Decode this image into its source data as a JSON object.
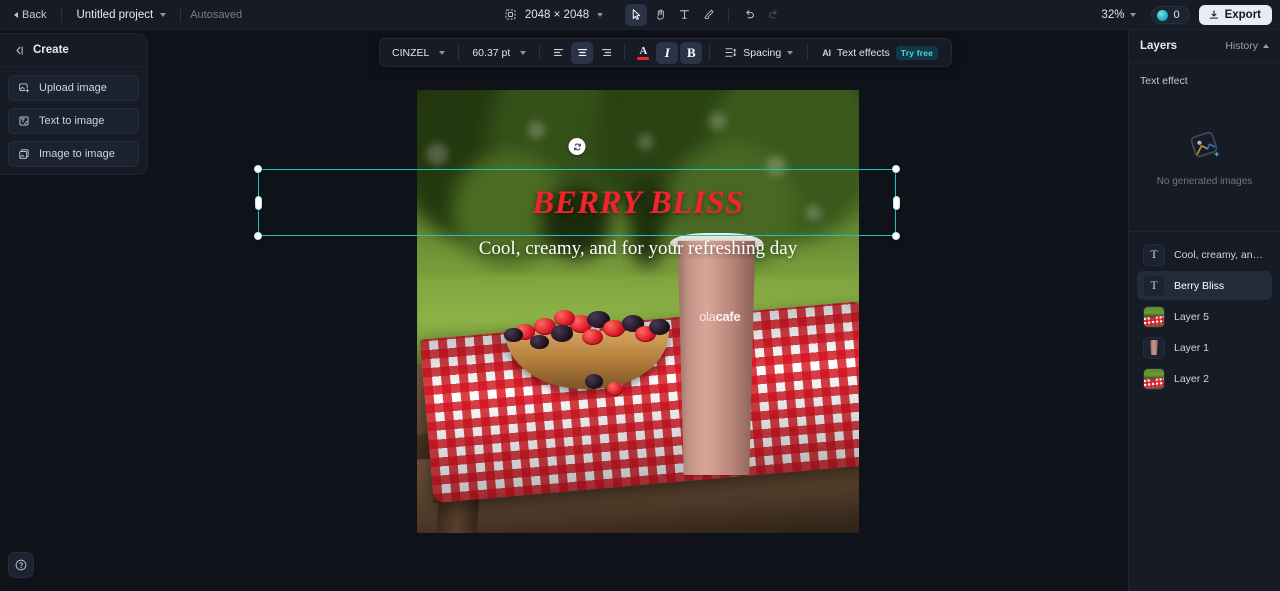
{
  "topbar": {
    "back_label": "Back",
    "project_name": "Untitled project",
    "autosaved_label": "Autosaved",
    "canvas_size": "2048 × 2048",
    "zoom_level": "32%",
    "credits_count": "0",
    "export_label": "Export",
    "tools": [
      {
        "name": "select-tool",
        "icon": "cursor-icon",
        "active": true
      },
      {
        "name": "hand-tool",
        "icon": "hand-icon",
        "active": false
      },
      {
        "name": "text-tool",
        "icon": "text-icon",
        "active": false
      },
      {
        "name": "brush-tool",
        "icon": "brush-icon",
        "active": false
      },
      {
        "name": "undo-tool",
        "icon": "undo-icon",
        "active": false
      },
      {
        "name": "redo-tool",
        "icon": "redo-icon",
        "active": false
      }
    ]
  },
  "left_panel": {
    "title": "Create",
    "collapse_icon": "collapse-panel-icon",
    "items": [
      {
        "label": "Upload image",
        "icon": "upload-image-icon"
      },
      {
        "label": "Text to image",
        "icon": "text-to-image-icon"
      },
      {
        "label": "Image to image",
        "icon": "image-to-image-icon"
      }
    ]
  },
  "text_toolbar": {
    "font_family": "CINZEL",
    "font_size": "60.37 pt",
    "align_left_icon": "align-left-icon",
    "align_center_icon": "align-center-icon",
    "align_right_icon": "align-right-icon",
    "text_color_letter": "A",
    "text_color_hex": "#f1242e",
    "italic_label": "I",
    "bold_label": "B",
    "spacing_label": "Spacing",
    "text_effects_label": "Text effects",
    "text_effects_badge": "Try free",
    "ai_badge": "AI"
  },
  "canvas": {
    "poster_title": "BERRY BLISS",
    "poster_subtitle": "Cool, creamy, and for your refreshing day",
    "cup_logo_prefix": "ola",
    "cup_logo_suffix": "cafe",
    "rotate_icon": "rotate-handle-icon",
    "selection_color": "#1fc3c3"
  },
  "right_panel": {
    "title": "Layers",
    "history_label": "History",
    "text_effect_label": "Text effect",
    "empty_state_label": "No generated images",
    "layers": [
      {
        "name": "Cool, creamy, and fo…",
        "thumb": "text",
        "selected": false
      },
      {
        "name": "Berry Bliss",
        "thumb": "text",
        "selected": true
      },
      {
        "name": "Layer 5",
        "thumb": "scene",
        "selected": false
      },
      {
        "name": "Layer 1",
        "thumb": "cup",
        "selected": false
      },
      {
        "name": "Layer 2",
        "thumb": "scene",
        "selected": false
      }
    ]
  },
  "help": {
    "icon": "help-question-icon"
  }
}
